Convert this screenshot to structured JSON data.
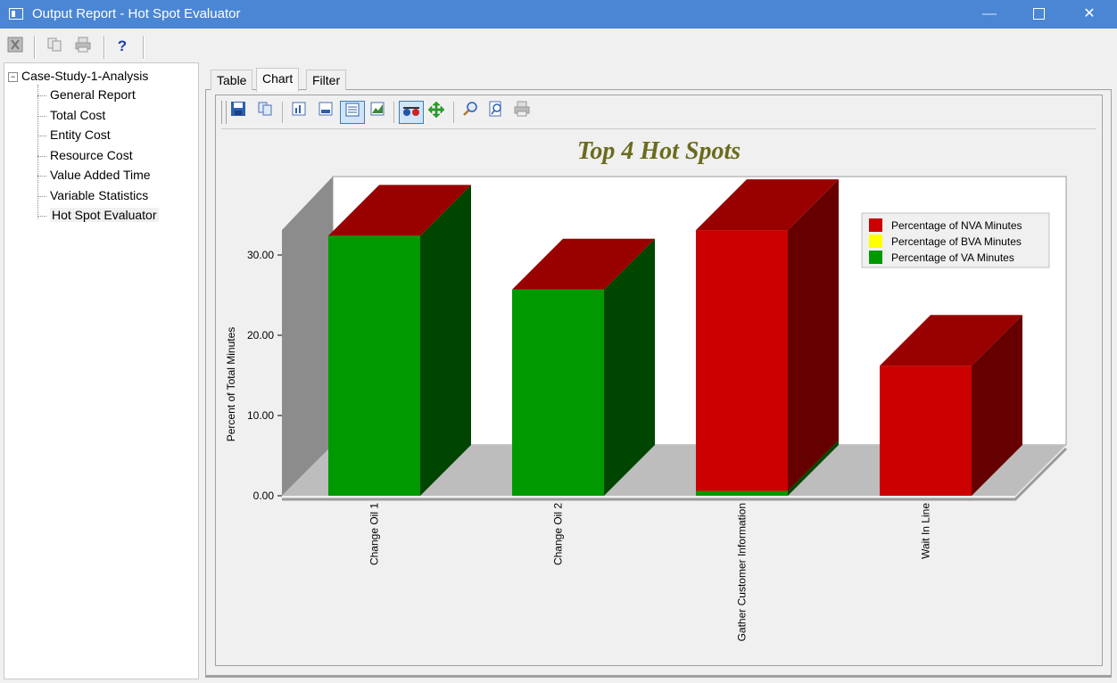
{
  "window": {
    "title": "Output Report - Hot Spot Evaluator"
  },
  "toolbar": {
    "icons": [
      "excel-icon",
      "copy-icon",
      "print-icon",
      "help-icon"
    ],
    "help_label": "?"
  },
  "tree": {
    "root": "Case-Study-1-Analysis",
    "expander": "−",
    "items": [
      "General Report",
      "Total Cost",
      "Entity Cost",
      "Resource Cost",
      "Value Added Time",
      "Variable Statistics",
      "Hot Spot Evaluator"
    ],
    "selected": "Hot Spot Evaluator"
  },
  "tabs": [
    {
      "label": "Table"
    },
    {
      "label": "Chart"
    },
    {
      "label": "Filter"
    }
  ],
  "active_tab": "Chart",
  "chart_toolbar": {
    "icons": [
      "save-icon",
      "copy-icon",
      "bar-chart-icon",
      "data-icon",
      "table-icon",
      "chart-type-icon",
      "3d-glasses-icon",
      "move-icon",
      "zoom-icon",
      "zoom-page-icon",
      "print-icon"
    ]
  },
  "colors": {
    "nva": "#cc0000",
    "bva": "#ffff00",
    "va": "#009900",
    "title": "#6b6b1e"
  },
  "chart_data": {
    "type": "bar",
    "title": "Top 4 Hot Spots",
    "ylabel": "Percent of Total Minutes",
    "xlabel": "",
    "ylim": [
      0,
      30
    ],
    "yticks": [
      "0.00",
      "10.00",
      "20.00",
      "30.00"
    ],
    "stacked": true,
    "three_d": true,
    "categories": [
      "Change Oil 1",
      "Change Oil 2",
      "Gather Customer Information",
      "Wait In Line"
    ],
    "series": [
      {
        "name": "Percentage of NVA Minutes",
        "values": [
          0,
          0,
          32.5,
          16.2
        ]
      },
      {
        "name": "Percentage of BVA Minutes",
        "values": [
          0,
          0,
          0,
          0
        ]
      },
      {
        "name": "Percentage of VA Minutes",
        "values": [
          32.4,
          25.7,
          0.6,
          0
        ]
      }
    ],
    "legend": "top-right"
  }
}
